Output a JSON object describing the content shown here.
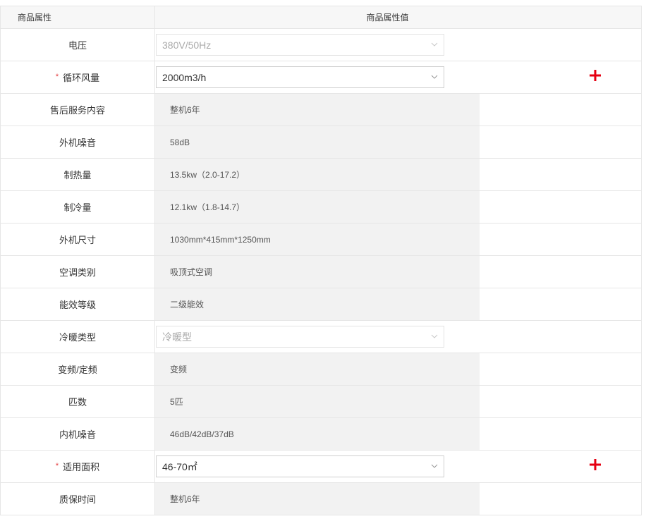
{
  "header": {
    "name": "商品属性",
    "value": "商品属性值"
  },
  "rows": [
    {
      "label": "电压",
      "value": "380V/50Hz",
      "kind": "select-disabled",
      "required": false
    },
    {
      "label": "循环风量",
      "value": "2000m3/h",
      "kind": "select",
      "required": true
    },
    {
      "label": "售后服务内容",
      "value": "整机6年",
      "kind": "static"
    },
    {
      "label": "外机噪音",
      "value": "58dB",
      "kind": "static"
    },
    {
      "label": "制热量",
      "value": "13.5kw（2.0-17.2）",
      "kind": "static"
    },
    {
      "label": "制冷量",
      "value": "12.1kw（1.8-14.7）",
      "kind": "static"
    },
    {
      "label": "外机尺寸",
      "value": "1030mm*415mm*1250mm",
      "kind": "static"
    },
    {
      "label": "空调类别",
      "value": "吸顶式空调",
      "kind": "static"
    },
    {
      "label": "能效等级",
      "value": "二级能效",
      "kind": "static"
    },
    {
      "label": "冷暖类型",
      "value": "冷暖型",
      "kind": "select-disabled"
    },
    {
      "label": "变频/定频",
      "value": "变频",
      "kind": "static"
    },
    {
      "label": "匹数",
      "value": "5匹",
      "kind": "static"
    },
    {
      "label": "内机噪音",
      "value": "46dB/42dB/37dB",
      "kind": "static"
    },
    {
      "label": "适用面积",
      "value": "46-70㎡",
      "kind": "select",
      "required": true
    },
    {
      "label": "质保时间",
      "value": "整机6年",
      "kind": "static"
    }
  ],
  "required_mark": "*",
  "colors": {
    "accent": "#e4393c",
    "static_bg": "#f2f2f2",
    "border": "#e6e6e6"
  },
  "icons": {
    "add": "plus-icon",
    "dropdown": "chevron-down-icon"
  }
}
